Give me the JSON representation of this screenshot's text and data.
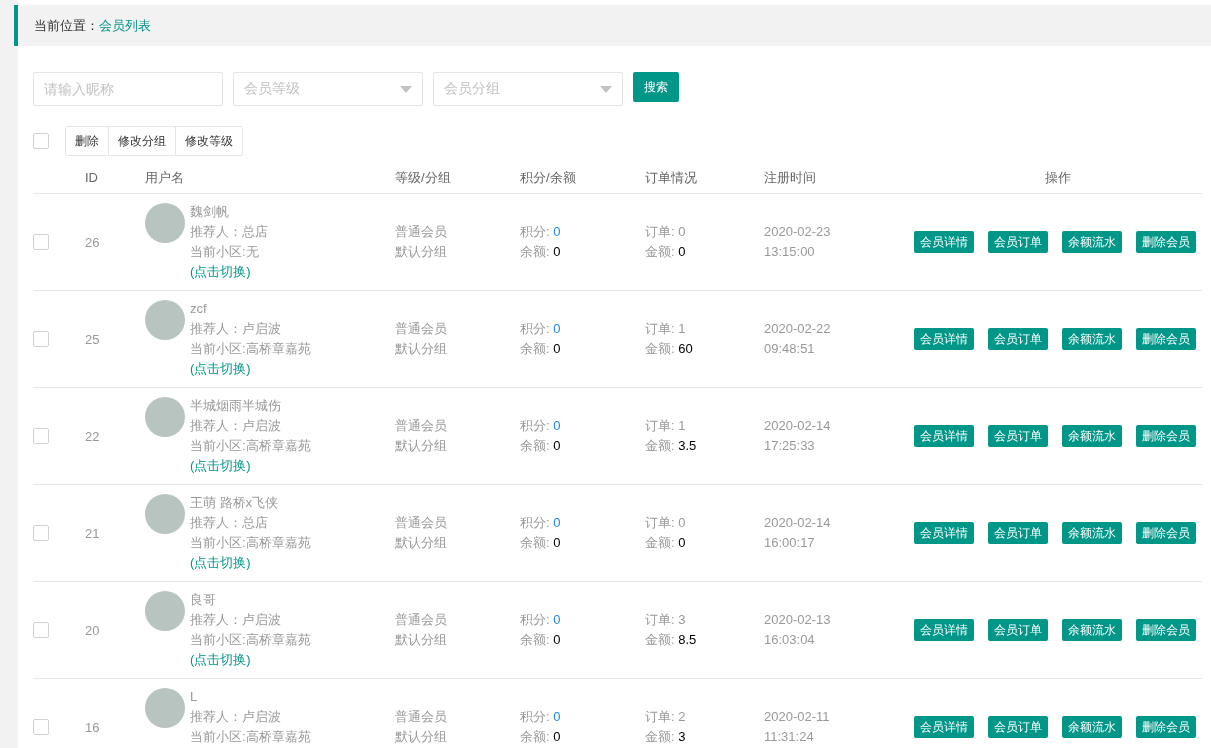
{
  "breadcrumb": {
    "label": "当前位置：",
    "current": "会员列表"
  },
  "filters": {
    "nickname": {
      "placeholder": "请输入昵称"
    },
    "level": {
      "placeholder": "会员等级"
    },
    "group": {
      "placeholder": "会员分组"
    },
    "search_button": "搜索"
  },
  "batch": {
    "select_all_checked": false,
    "buttons": [
      "删除",
      "修改分组",
      "修改等级"
    ]
  },
  "table": {
    "columns": [
      "ID",
      "用户名",
      "等级/分组",
      "积分/余额",
      "订单情况",
      "注册时间",
      "操作"
    ],
    "rows": [
      {
        "checked": false,
        "id": "26",
        "name": "魏剑帆",
        "referrer": "推荐人：总店",
        "community": "当前小区:无",
        "switch_link": "(点击切换)",
        "level": "普通会员",
        "group": "默认分组",
        "points_label": "积分:",
        "points": "0",
        "balance_label": "余额:",
        "balance": "0",
        "orders": "订单: 0",
        "amount_label": "金额:",
        "amount": "0",
        "date": "2020-02-23",
        "time": "13:15:00",
        "actions": [
          "会员详情",
          "会员订单",
          "余额流水",
          "删除会员"
        ]
      },
      {
        "checked": false,
        "id": "25",
        "name": "zcf",
        "referrer": "推荐人：卢启波",
        "community": "当前小区:高桥章嘉苑",
        "switch_link": "(点击切换)",
        "level": "普通会员",
        "group": "默认分组",
        "points_label": "积分:",
        "points": "0",
        "balance_label": "余额:",
        "balance": "0",
        "orders": "订单: 1",
        "amount_label": "金额:",
        "amount": "60",
        "date": "2020-02-22",
        "time": "09:48:51",
        "actions": [
          "会员详情",
          "会员订单",
          "余额流水",
          "删除会员"
        ]
      },
      {
        "checked": false,
        "id": "22",
        "name": "半城烟雨半城伤",
        "referrer": "推荐人：卢启波",
        "community": "当前小区:高桥章嘉苑",
        "switch_link": "(点击切换)",
        "level": "普通会员",
        "group": "默认分组",
        "points_label": "积分:",
        "points": "0",
        "balance_label": "余额:",
        "balance": "0",
        "orders": "订单: 1",
        "amount_label": "金额:",
        "amount": "3.5",
        "date": "2020-02-14",
        "time": "17:25:33",
        "actions": [
          "会员详情",
          "会员订单",
          "余额流水",
          "删除会员"
        ]
      },
      {
        "checked": false,
        "id": "21",
        "name": "王萌 路桥x飞侠",
        "referrer": "推荐人：总店",
        "community": "当前小区:高桥章嘉苑",
        "switch_link": "(点击切换)",
        "level": "普通会员",
        "group": "默认分组",
        "points_label": "积分:",
        "points": "0",
        "balance_label": "余额:",
        "balance": "0",
        "orders": "订单: 0",
        "amount_label": "金额:",
        "amount": "0",
        "date": "2020-02-14",
        "time": "16:00:17",
        "actions": [
          "会员详情",
          "会员订单",
          "余额流水",
          "删除会员"
        ]
      },
      {
        "checked": false,
        "id": "20",
        "name": "良哥",
        "referrer": "推荐人：卢启波",
        "community": "当前小区:高桥章嘉苑",
        "switch_link": "(点击切换)",
        "level": "普通会员",
        "group": "默认分组",
        "points_label": "积分:",
        "points": "0",
        "balance_label": "余额:",
        "balance": "0",
        "orders": "订单: 3",
        "amount_label": "金额:",
        "amount": "8.5",
        "date": "2020-02-13",
        "time": "16:03:04",
        "actions": [
          "会员详情",
          "会员订单",
          "余额流水",
          "删除会员"
        ]
      },
      {
        "checked": false,
        "id": "16",
        "name": "L",
        "referrer": "推荐人：卢启波",
        "community": "当前小区:高桥章嘉苑",
        "level": "普通会员",
        "group": "默认分组",
        "points_label": "积分:",
        "points": "0",
        "balance_label": "余额:",
        "balance": "0",
        "orders": "订单: 2",
        "amount_label": "金额:",
        "amount": "3",
        "date": "2020-02-11",
        "time": "11:31:24",
        "actions": [
          "会员详情",
          "会员订单",
          "余额流水",
          "删除会员"
        ]
      }
    ]
  }
}
